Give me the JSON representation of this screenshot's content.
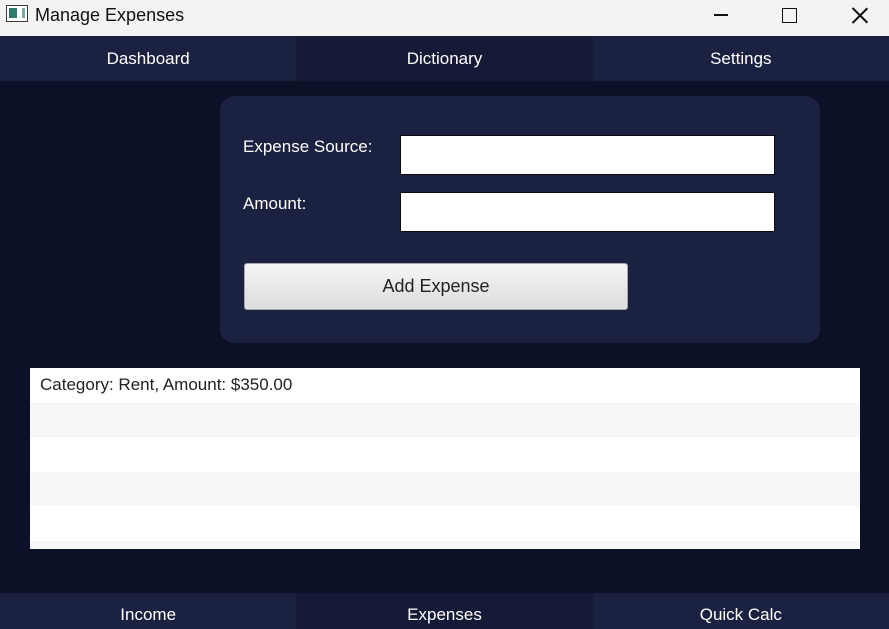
{
  "window": {
    "title": "Manage Expenses",
    "controls": [
      "minimize-icon",
      "maximize-icon",
      "close-icon"
    ]
  },
  "top_nav": {
    "tabs": [
      {
        "label": "Dashboard"
      },
      {
        "label": "Dictionary"
      },
      {
        "label": "Settings"
      }
    ]
  },
  "form": {
    "source_label": "Expense Source:",
    "source_value": "",
    "amount_label": "Amount:",
    "amount_value": "",
    "add_button_label": "Add Expense"
  },
  "expense_list": {
    "items": [
      {
        "text": "Category: Rent, Amount: $350.00"
      },
      {
        "text": ""
      },
      {
        "text": ""
      },
      {
        "text": ""
      },
      {
        "text": ""
      },
      {
        "text": ""
      }
    ]
  },
  "bottom_nav": {
    "tabs": [
      {
        "label": "Income"
      },
      {
        "label": "Expenses"
      },
      {
        "label": "Quick Calc"
      }
    ]
  },
  "colors": {
    "background": "#0c1127",
    "panel": "#1b2140",
    "text": "#ffffff"
  }
}
